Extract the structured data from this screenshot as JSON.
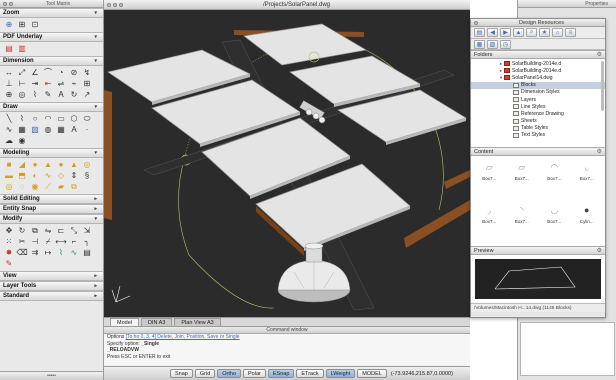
{
  "tool_palette": {
    "title": "Tool Matrix",
    "sections": [
      {
        "label": "Zoom",
        "icons": [
          "zoom-realtime-icon",
          "zoom-window-icon",
          "zoom-extents-icon"
        ]
      },
      {
        "label": "PDF Underlay",
        "icons": [
          "pdf-attach-icon",
          "pdf-clip-icon"
        ]
      },
      {
        "label": "Dimension",
        "icons": [
          "linear-dim-icon",
          "aligned-dim-icon",
          "angular-dim-icon",
          "arc-dim-icon",
          "radius-dim-icon",
          "diameter-dim-icon",
          "jogged-dim-icon",
          "ordinate-dim-icon",
          "baseline-dim-icon",
          "continue-dim-icon",
          "quick-dim-icon",
          "dim-space-icon",
          "dim-break-icon",
          "tolerance-icon",
          "center-mark-icon",
          "inspect-icon",
          "jog-line-icon",
          "dim-edit-icon",
          "dim-text-edit-icon",
          "dim-update-icon",
          "leader-icon"
        ]
      },
      {
        "label": "Draw",
        "icons": [
          "line-icon",
          "polyline-icon",
          "circle-icon",
          "arc-icon",
          "rectangle-icon",
          "polygon-icon",
          "ellipse-icon",
          "spline-icon",
          "hatch-icon",
          "gradient-icon",
          "region-icon",
          "table-icon",
          "mtext-icon",
          "point-icon",
          "revcloud-icon",
          "donut-icon"
        ]
      },
      {
        "label": "Modeling",
        "icons": [
          "box-icon",
          "wedge-icon",
          "cylinder-icon",
          "cone-icon",
          "sphere-icon",
          "pyramid-icon",
          "torus-icon",
          "polysolid-icon",
          "extrude-icon",
          "revolve-icon",
          "sweep-icon",
          "loft-icon",
          "presspull-icon",
          "helix-icon",
          "union-icon",
          "subtract-icon",
          "intersect-icon",
          "slice-icon",
          "thicken-icon",
          "interfere-icon"
        ]
      },
      {
        "label": "Solid Editing",
        "icons": []
      },
      {
        "label": "Entity Snap",
        "icons": []
      },
      {
        "label": "Modify",
        "icons": [
          "move-icon",
          "rotate-icon",
          "copy-icon",
          "mirror-icon",
          "offset-icon",
          "scale-icon",
          "stretch-icon",
          "array-icon",
          "trim-icon",
          "extend-icon",
          "break-icon",
          "join-icon",
          "chamfer-icon",
          "fillet-icon",
          "explode-icon",
          "erase-icon",
          "align-icon",
          "lengthen-icon",
          "edit-polyline-icon",
          "edit-spline-icon",
          "properties-icon",
          "match-prop-icon"
        ]
      },
      {
        "label": "View",
        "icons": []
      },
      {
        "label": "Layer Tools",
        "icons": []
      },
      {
        "label": "Standard",
        "icons": []
      }
    ]
  },
  "drawing_window": {
    "title": "/Projects/SolarPanel.dwg",
    "layout_tabs": [
      {
        "label": "Model",
        "active": true
      },
      {
        "label": "DIN A3",
        "active": false
      },
      {
        "label": "Plan View A3",
        "active": false
      }
    ],
    "command_window": {
      "title": "Command window",
      "lines": [
        {
          "prefix": "Options ",
          "keywords": "[To ho 2, 3, 4] Delete, Join, Position, Save or Single",
          "suffix": ""
        },
        {
          "prefix": "Specify option: ",
          "keywords": "",
          "suffix": "_Single"
        },
        {
          "prefix": "",
          "keywords": "",
          "suffix": "_RELOADVW"
        },
        {
          "prefix": "Press ESC or ENTER to exit",
          "keywords": "",
          "suffix": ""
        }
      ]
    },
    "status_buttons": [
      {
        "label": "Snap",
        "on": false
      },
      {
        "label": "Grid",
        "on": false
      },
      {
        "label": "Ortho",
        "on": true
      },
      {
        "label": "Polar",
        "on": false
      },
      {
        "label": "ESnap",
        "on": true
      },
      {
        "label": "ETrack",
        "on": false
      },
      {
        "label": "LWeight",
        "on": true
      },
      {
        "label": "MODEL",
        "on": false
      }
    ],
    "coordinates": "(-73.9246,215.87,0.0000)"
  },
  "design_resources": {
    "title": "Design Resources",
    "folders_label": "Folders",
    "content_label": "Content",
    "preview_label": "Preview",
    "tree": [
      {
        "label": "SolarBuilding-2014e.d",
        "indent": 3,
        "twisty": "▸",
        "type": "dwg",
        "selected": false
      },
      {
        "label": "SolarBuilding-2014e.d",
        "indent": 3,
        "twisty": "▸",
        "type": "dwg",
        "selected": false
      },
      {
        "label": "SolarPanel14.dwg",
        "indent": 3,
        "twisty": "▾",
        "type": "dwg",
        "selected": false
      },
      {
        "label": "Blocks",
        "indent": 4,
        "twisty": "",
        "type": "folder",
        "selected": true
      },
      {
        "label": "Dimension Styles",
        "indent": 4,
        "twisty": "",
        "type": "folder",
        "selected": false
      },
      {
        "label": "Layers",
        "indent": 4,
        "twisty": "",
        "type": "folder",
        "selected": false
      },
      {
        "label": "Line Styles",
        "indent": 4,
        "twisty": "",
        "type": "folder",
        "selected": false
      },
      {
        "label": "Reference Drawing",
        "indent": 4,
        "twisty": "",
        "type": "folder",
        "selected": false
      },
      {
        "label": "Sheets",
        "indent": 4,
        "twisty": "",
        "type": "folder",
        "selected": false
      },
      {
        "label": "Table Styles",
        "indent": 4,
        "twisty": "",
        "type": "folder",
        "selected": false
      },
      {
        "label": "Text Styles",
        "indent": 4,
        "twisty": "",
        "type": "folder",
        "selected": false
      }
    ],
    "content_items": [
      {
        "label": "Box7...",
        "glyph": "▱"
      },
      {
        "label": "Box7...",
        "glyph": "▱"
      },
      {
        "label": "Box7...",
        "glyph": "◠"
      },
      {
        "label": "Box7...",
        "glyph": "◟"
      },
      {
        "label": "Box7...",
        "glyph": "◞"
      },
      {
        "label": "Box7...",
        "glyph": "◝"
      },
      {
        "label": "Box7...",
        "glyph": "◡"
      },
      {
        "label": "Cylin...",
        "glyph": "●"
      }
    ],
    "status": "/Volumes/Macintosh H...14.dwg (1145 Blocks)"
  },
  "properties": {
    "title": "Properties"
  },
  "colors": {
    "viewport_bg": "#2b2b2b",
    "panel_fill": "#e4e4e4",
    "panel_edge": "#9a9a9a",
    "frame_wood": "#8a4f22",
    "selection_blue": "#c5cfdd"
  }
}
